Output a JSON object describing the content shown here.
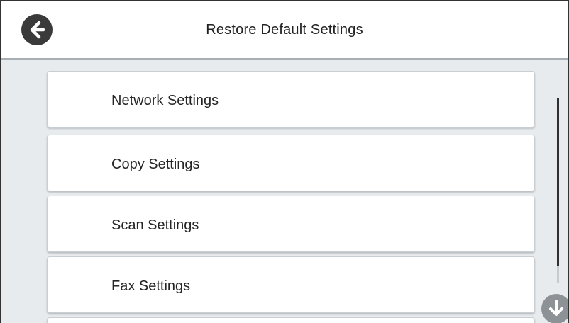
{
  "header": {
    "title": "Restore Default Settings",
    "back_icon": "back-arrow-icon"
  },
  "menu": {
    "items": [
      {
        "label": "Network Settings"
      },
      {
        "label": "Copy Settings"
      },
      {
        "label": "Scan Settings"
      },
      {
        "label": "Fax Settings"
      }
    ]
  },
  "scroll": {
    "down_icon": "scroll-down-arrow-icon"
  },
  "colors": {
    "background": "#e7ebee",
    "header": "#ffffff",
    "button_dark": "#3a3a3a",
    "scroll_button": "#8d9296"
  }
}
